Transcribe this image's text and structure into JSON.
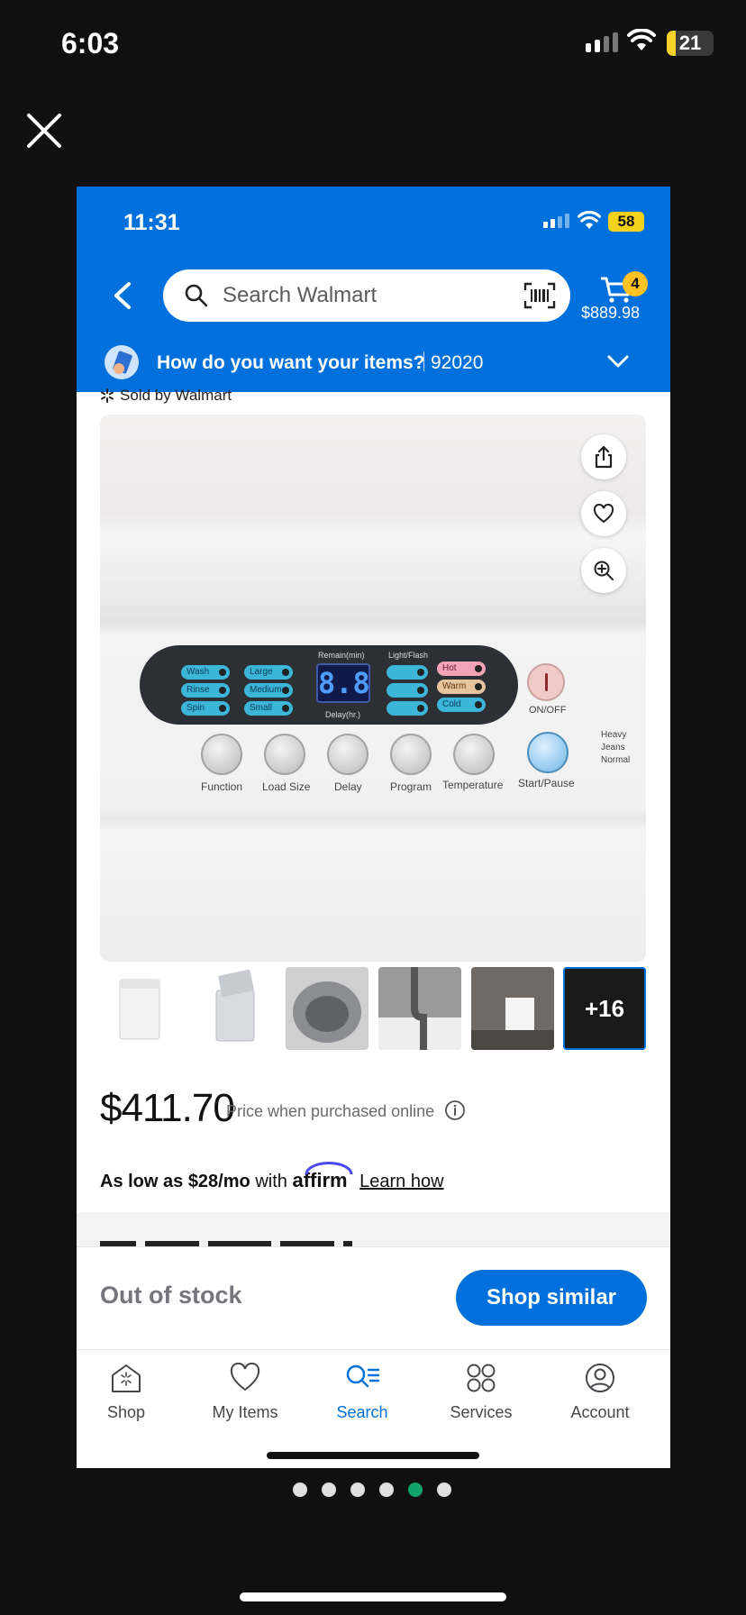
{
  "outer_status": {
    "time": "6:03",
    "battery": "21"
  },
  "inner_status": {
    "time": "11:31",
    "battery": "58"
  },
  "search": {
    "placeholder": "Search Walmart"
  },
  "cart": {
    "count": "4",
    "total": "$889.98"
  },
  "delivery": {
    "prompt": "How do you want your items?",
    "zip": "92020"
  },
  "product": {
    "sold_by": "Sold by Walmart",
    "panel_labels": {
      "remain": "Remain(min)",
      "light_flash": "Light/Flash",
      "delay_hr": "Delay(hr.)",
      "on_off": "ON/OFF",
      "display": "8.8",
      "wash_pills": [
        "Wash",
        "Rinse",
        "Spin"
      ],
      "size_pills": [
        "Large",
        "Medium",
        "Small"
      ],
      "temp_pills": [
        "Hot",
        "Warm",
        "Cold"
      ],
      "buttons": [
        "Function",
        "Load Size",
        "Delay",
        "Program",
        "Temperature",
        "Start/Pause"
      ],
      "modes": [
        "Heavy",
        "Jeans",
        "Normal"
      ]
    },
    "more_images": "+16",
    "price": "$411.70",
    "price_note": "Price when purchased online",
    "affirm": {
      "prefix": "As low as $28/mo",
      "with": "with",
      "brand": "affirm",
      "link": "Learn how"
    }
  },
  "actions": {
    "status": "Out of stock",
    "shop_similar": "Shop similar"
  },
  "tabs": [
    {
      "label": "Shop",
      "icon": "shop-icon"
    },
    {
      "label": "My Items",
      "icon": "heart-icon"
    },
    {
      "label": "Search",
      "icon": "search-list-icon"
    },
    {
      "label": "Services",
      "icon": "services-grid-icon"
    },
    {
      "label": "Account",
      "icon": "account-icon"
    }
  ],
  "pager": {
    "count": 6,
    "active_index": 4
  },
  "colors": {
    "brand_blue": "#0071dc",
    "spark_yellow": "#ffc220",
    "active_dot": "#10a36a"
  }
}
